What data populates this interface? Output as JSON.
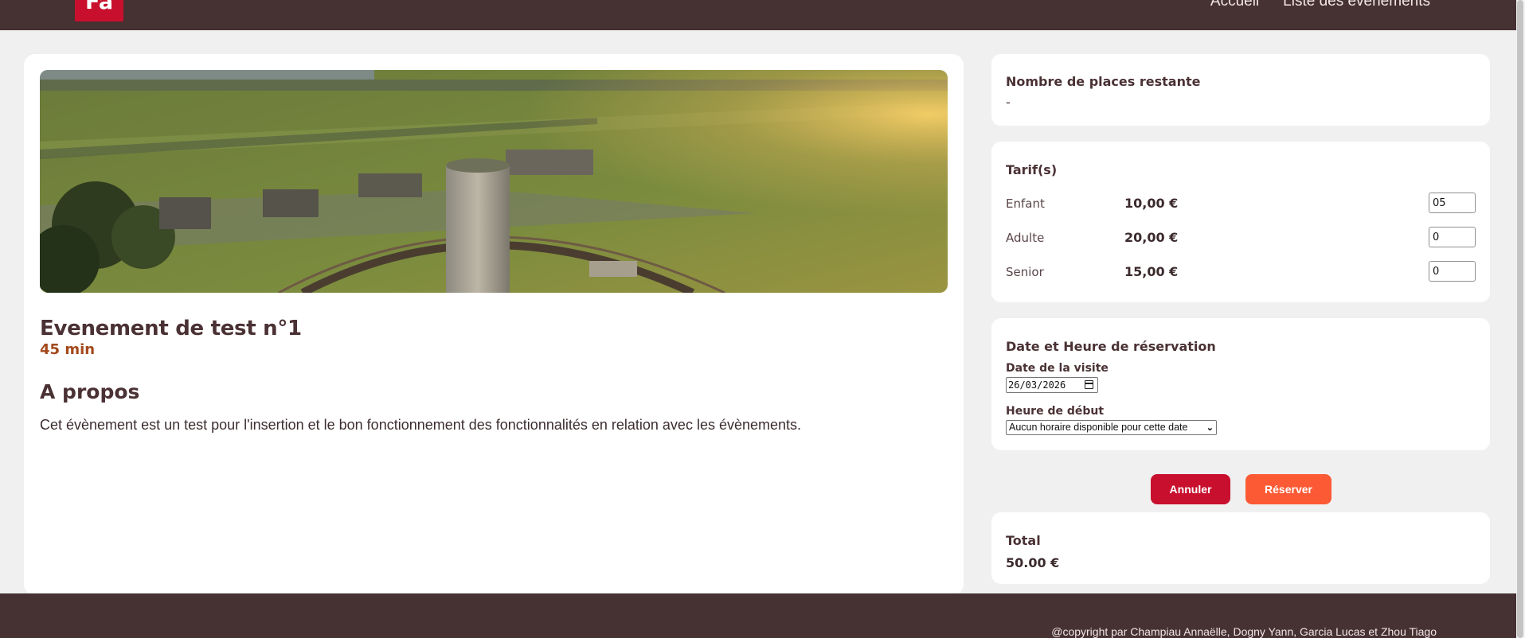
{
  "header": {
    "logo_text": "Fa",
    "nav": [
      "Accueil",
      "Liste des événements"
    ]
  },
  "event": {
    "title": "Evenement de test n°1",
    "duration": "45 min",
    "about_heading": "A propos",
    "description": "Cet évènement est un test pour l'insertion et le bon fonctionnement des fonctionnalités en relation avec les évènements."
  },
  "places": {
    "heading": "Nombre de places restante",
    "value": "-"
  },
  "tarifs": {
    "heading": "Tarif(s)",
    "rows": [
      {
        "label": "Enfant",
        "price": "10,00 €",
        "qty": "05"
      },
      {
        "label": "Adulte",
        "price": "20,00 €",
        "qty": "0"
      },
      {
        "label": "Senior",
        "price": "15,00 €",
        "qty": "0"
      }
    ]
  },
  "reservation": {
    "heading": "Date et Heure de réservation",
    "date_label": "Date de la visite",
    "date_value": "26/03/2026",
    "time_label": "Heure de début",
    "time_value": "Aucun horaire disponible pour cette date"
  },
  "actions": {
    "cancel_label": "Annuler",
    "reserve_label": "Réserver"
  },
  "total": {
    "heading": "Total",
    "value": "50.00 €"
  },
  "footer": {
    "copyright": "@copyright par Champiau Annaëlle, Dogny Yann, Garcia Lucas et Zhou Tiago"
  },
  "colors": {
    "header_bg": "#463133",
    "brand_red": "#c8102e",
    "reserve_orange": "#fc5a34",
    "duration_brown": "#a3481b"
  },
  "icons": {
    "date_picker": "calendar-icon",
    "select": "chevron-down-icon"
  }
}
